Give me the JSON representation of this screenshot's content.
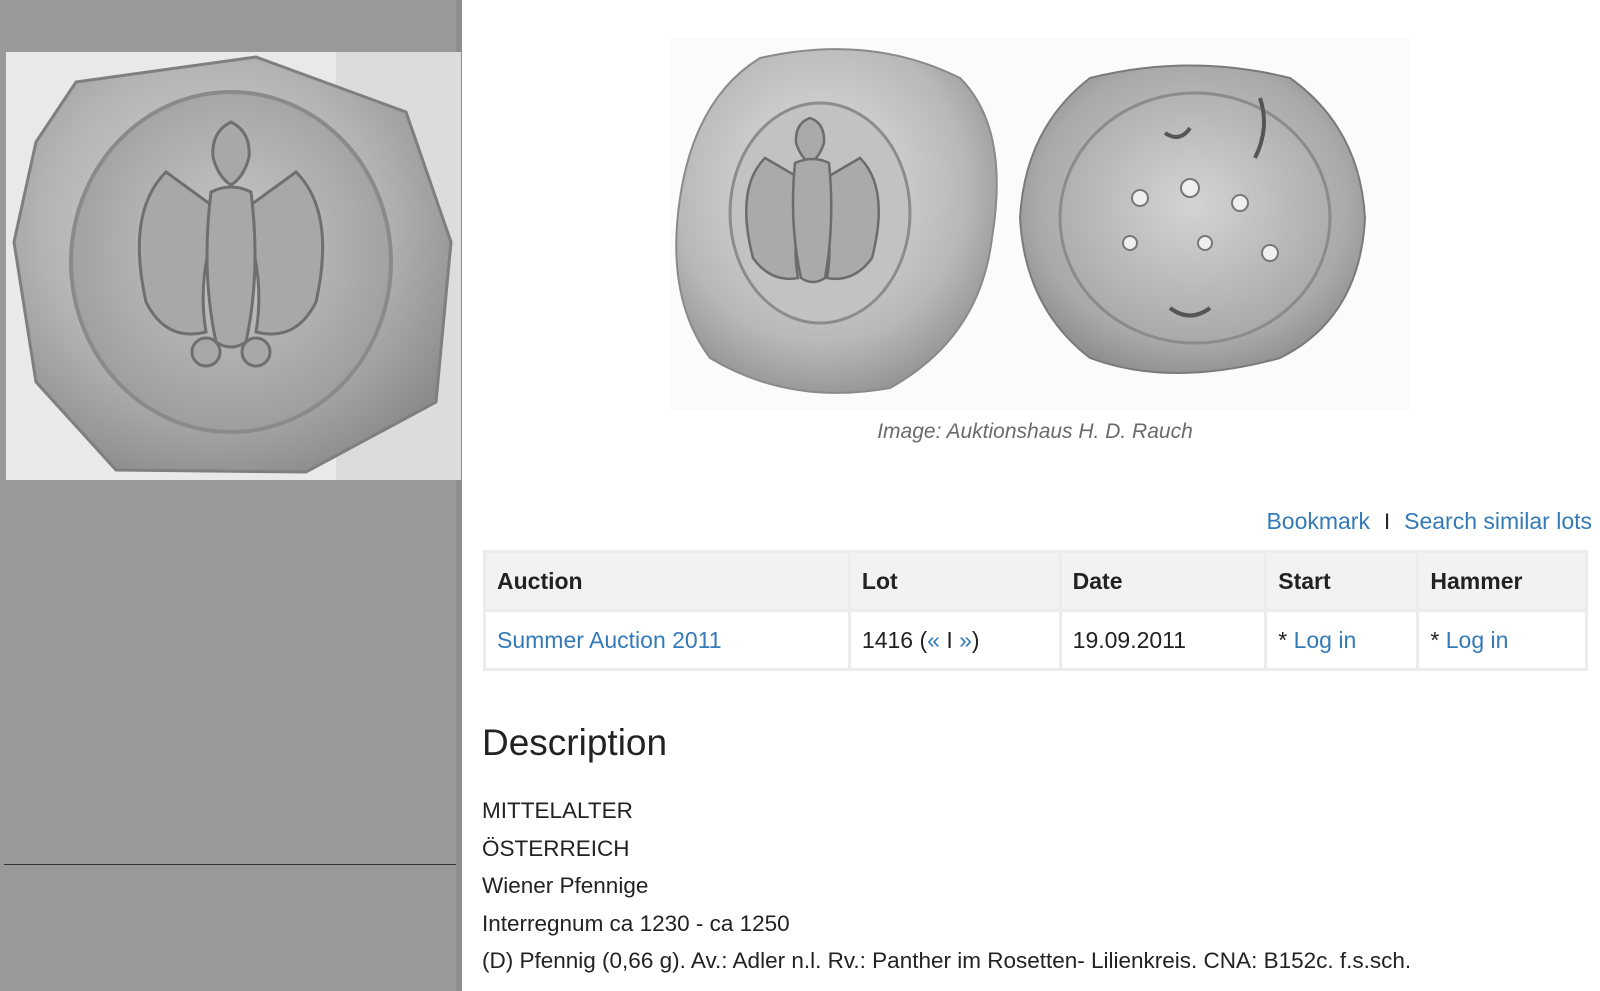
{
  "image_credit": "Image: Auktionshaus H. D. Rauch",
  "links": {
    "bookmark": "Bookmark",
    "separator": "I",
    "search_similar": "Search similar lots"
  },
  "table": {
    "headers": {
      "auction": "Auction",
      "lot": "Lot",
      "date": "Date",
      "start": "Start",
      "hammer": "Hammer"
    },
    "row": {
      "auction": "Summer Auction 2011",
      "lot_number": "1416",
      "lot_prev": "«",
      "lot_sep": "I",
      "lot_next": "»",
      "date": "19.09.2011",
      "start_prefix": "* ",
      "start_link": "Log in",
      "hammer_prefix": "* ",
      "hammer_link": "Log in"
    }
  },
  "description": {
    "title": "Description",
    "lines": [
      "MITTELALTER",
      "ÖSTERREICH",
      "Wiener Pfennige",
      "Interregnum ca 1230 - ca 1250",
      "(D) Pfennig (0,66 g). Av.: Adler n.l. Rv.: Panther im Rosetten- Lilienkreis. CNA: B152c. f.s.sch."
    ]
  },
  "colors": {
    "link": "#337ab7",
    "left_panel": "#999999",
    "header_bg": "#f2f2f2"
  }
}
